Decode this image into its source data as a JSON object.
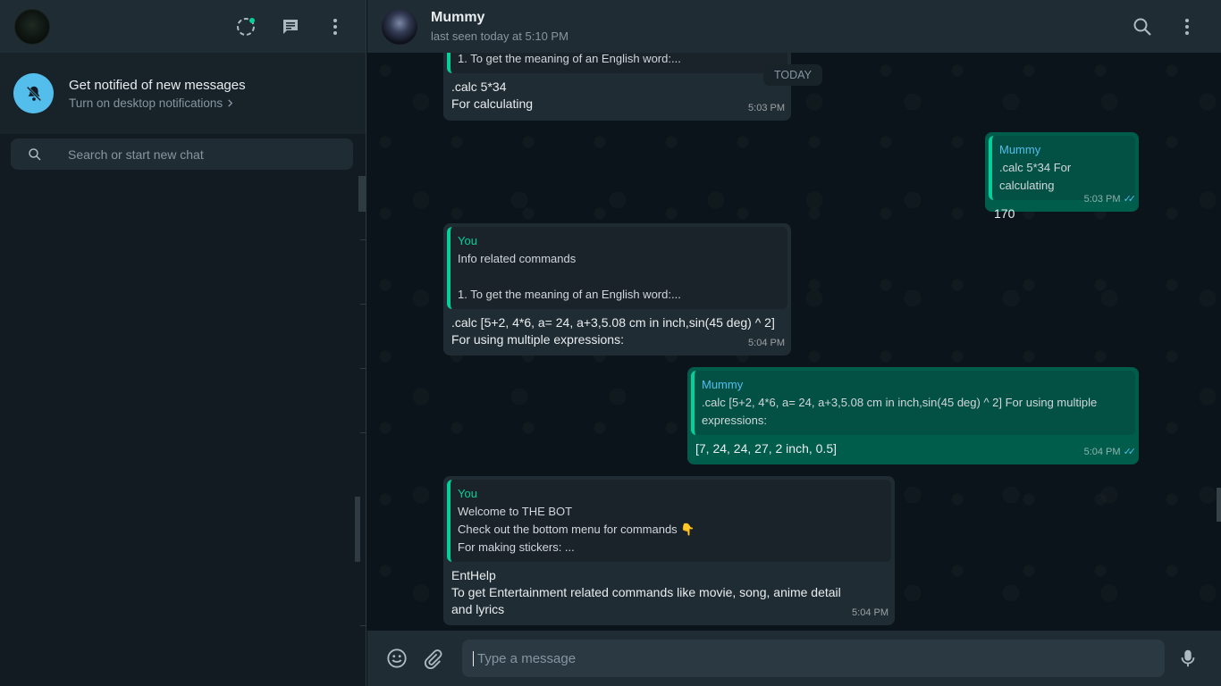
{
  "colors": {
    "accent": "#06cf9c",
    "outgoing_bubble": "#005c4b",
    "incoming_bubble": "#202c33",
    "link_blue": "#53bdeb"
  },
  "sidebar": {
    "icons": [
      "status-icon",
      "new-chat-icon",
      "menu-icon"
    ],
    "notification": {
      "title": "Get notified of new messages",
      "subtitle": "Turn on desktop notifications",
      "icon": "bell-off-icon"
    },
    "search": {
      "placeholder": "Search or start new chat"
    }
  },
  "chat": {
    "contact_name": "Mummy",
    "status": "last seen today at 5:10 PM",
    "icons": [
      "search-icon",
      "menu-icon"
    ],
    "date_chip": "TODAY",
    "messages": [
      {
        "direction": "in",
        "quote_text": "1. To get the meaning of an English word:...",
        "lines": [
          ".calc 5*34",
          "For calculating"
        ],
        "time": "5:03 PM"
      },
      {
        "direction": "out",
        "quote_author": "Mummy",
        "quote_text": ".calc 5*34 For calculating",
        "lines": [
          "170"
        ],
        "time": "5:03 PM"
      },
      {
        "direction": "in",
        "quote_author": "You",
        "quote_lines": [
          "Info related commands",
          "",
          "1. To get the meaning of an English word:..."
        ],
        "lines": [
          ".calc [5+2, 4*6, a= 24, a+3,5.08 cm in inch,sin(45 deg) ^ 2]",
          "For using multiple expressions:"
        ],
        "time": "5:04 PM"
      },
      {
        "direction": "out",
        "quote_author": "Mummy",
        "quote_text": ".calc [5+2, 4*6, a= 24, a+3,5.08 cm in inch,sin(45 deg) ^ 2] For using multiple expressions:",
        "lines": [
          "[7, 24, 24, 27, 2 inch, 0.5]"
        ],
        "time": "5:04 PM"
      },
      {
        "direction": "in",
        "quote_author": "You",
        "quote_lines": [
          "Welcome to THE BOT",
          "Check out the bottom menu for commands 👇",
          "For making stickers: ..."
        ],
        "lines": [
          "EntHelp",
          "To get Entertainment related commands like movie, song, anime detail and lyrics"
        ],
        "time": "5:04 PM"
      }
    ]
  },
  "composer": {
    "placeholder": "Type a message",
    "icons": [
      "emoji-icon",
      "attach-icon",
      "mic-icon"
    ]
  }
}
